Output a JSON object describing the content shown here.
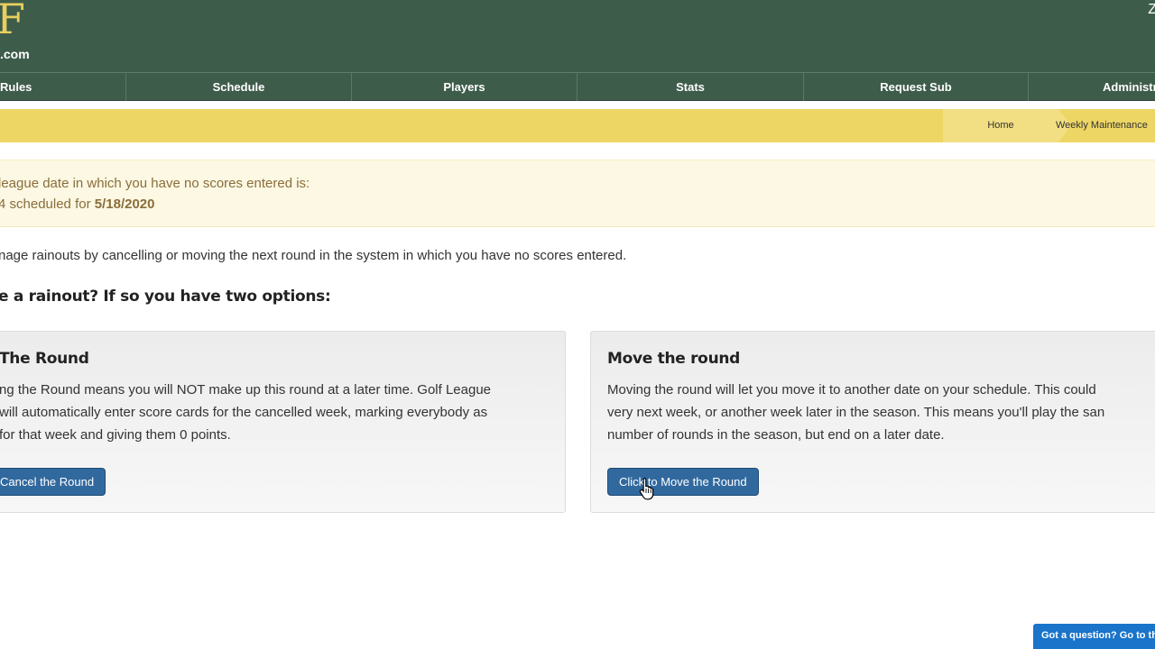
{
  "header": {
    "logo_big": "F",
    "logo_small": ".com",
    "corner_text": "Z"
  },
  "nav": {
    "items": [
      {
        "label": "Rules"
      },
      {
        "label": "Schedule"
      },
      {
        "label": "Players"
      },
      {
        "label": "Stats"
      },
      {
        "label": "Request Sub"
      },
      {
        "label": "Administra"
      }
    ]
  },
  "breadcrumb": {
    "home": "Home",
    "current": "Weekly Maintenance"
  },
  "notice": {
    "line1": "league date in which you have no scores entered is:",
    "line2_prefix": "4 scheduled for ",
    "line2_date": "5/18/2020"
  },
  "intro": "nage rainouts by cancelling or moving the next round in the system in which you have no scores entered.",
  "question": "e a rainout? If so you have two options:",
  "cards": {
    "cancel": {
      "title": "The Round",
      "lines": [
        "ng the Round means you will NOT make up this round at a later time. Golf League",
        "will automatically enter score cards for the cancelled week, marking everybody as",
        "for that week and giving them 0 points."
      ],
      "button": "Cancel the Round"
    },
    "move": {
      "title": "Move the round",
      "lines": [
        "Moving the round will let you move it to another date on your schedule. This could",
        "very next week, or another week later in the season. This means you'll play the san",
        "number of rounds in the season, but end on a later date."
      ],
      "button": "Click to Move the Round"
    }
  },
  "help_tab": "Got a question? Go to the",
  "colors": {
    "header_bg": "#3e5c4a",
    "logo_gold": "#e8cf5e",
    "breadcrumb_bar": "#edd664",
    "notice_bg": "#fcf8e3",
    "notice_text": "#8a6d3b",
    "button_blue": "#31699f",
    "help_tab_blue": "#1a74c9"
  }
}
